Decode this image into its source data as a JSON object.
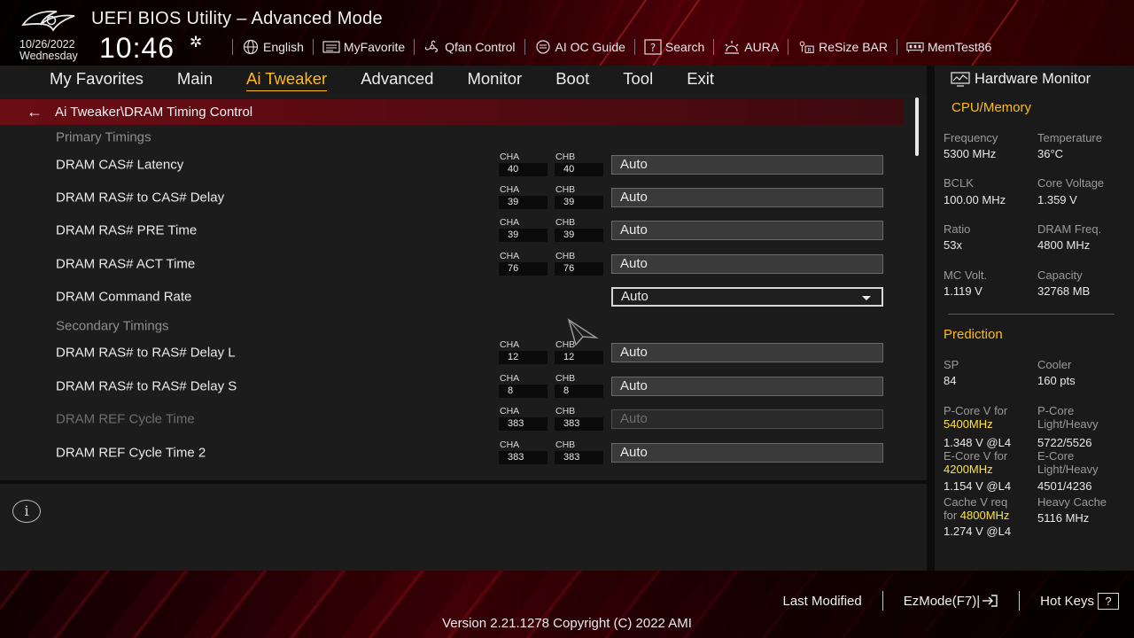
{
  "header": {
    "title": "UEFI BIOS Utility – Advanced Mode",
    "date": "10/26/2022",
    "weekday": "Wednesday",
    "time": "10:46"
  },
  "toolbar": {
    "items": [
      {
        "label": "English",
        "icon": "globe-icon"
      },
      {
        "label": "MyFavorite",
        "icon": "favorite-icon"
      },
      {
        "label": "Qfan Control",
        "icon": "fan-icon"
      },
      {
        "label": "AI OC Guide",
        "icon": "ai-chip-icon"
      },
      {
        "label": "Search",
        "icon": "search-icon"
      },
      {
        "label": "AURA",
        "icon": "aura-icon"
      },
      {
        "label": "ReSize BAR",
        "icon": "resize-bar-icon"
      },
      {
        "label": "MemTest86",
        "icon": "memtest-icon"
      }
    ]
  },
  "nav": {
    "tabs": [
      "My Favorites",
      "Main",
      "Ai Tweaker",
      "Advanced",
      "Monitor",
      "Boot",
      "Tool",
      "Exit"
    ],
    "active": "Ai Tweaker"
  },
  "breadcrumb": "Ai Tweaker\\DRAM Timing Control",
  "channel_labels": {
    "a": "CHA",
    "b": "CHB"
  },
  "settings": {
    "primary_header": "Primary Timings",
    "secondary_header": "Secondary Timings",
    "cas_latency": {
      "label": "DRAM CAS# Latency",
      "cha": "40",
      "chb": "40",
      "value": "Auto"
    },
    "ras_to_cas": {
      "label": "DRAM RAS# to CAS# Delay",
      "cha": "39",
      "chb": "39",
      "value": "Auto"
    },
    "ras_pre": {
      "label": "DRAM RAS# PRE Time",
      "cha": "39",
      "chb": "39",
      "value": "Auto"
    },
    "ras_act": {
      "label": "DRAM RAS# ACT Time",
      "cha": "76",
      "chb": "76",
      "value": "Auto"
    },
    "command_rate": {
      "label": "DRAM Command Rate",
      "value": "Auto"
    },
    "ras_to_ras_l": {
      "label": "DRAM RAS# to RAS# Delay L",
      "cha": "12",
      "chb": "12",
      "value": "Auto"
    },
    "ras_to_ras_s": {
      "label": "DRAM RAS# to RAS# Delay S",
      "cha": "8",
      "chb": "8",
      "value": "Auto"
    },
    "ref_cycle": {
      "label": "DRAM REF Cycle Time",
      "cha": "383",
      "chb": "383",
      "value": "Auto"
    },
    "ref_cycle_2": {
      "label": "DRAM REF Cycle Time 2",
      "cha": "383",
      "chb": "383",
      "value": "Auto"
    }
  },
  "hw_monitor": {
    "title": "Hardware Monitor",
    "cpu_memory_title": "CPU/Memory",
    "frequency_label": "Frequency",
    "frequency": "5300 MHz",
    "temperature_label": "Temperature",
    "temperature": "36°C",
    "bclk_label": "BCLK",
    "bclk": "100.00 MHz",
    "core_voltage_label": "Core Voltage",
    "core_voltage": "1.359 V",
    "ratio_label": "Ratio",
    "ratio": "53x",
    "dram_freq_label": "DRAM Freq.",
    "dram_freq": "4800 MHz",
    "mc_volt_label": "MC Volt.",
    "mc_volt": "1.119 V",
    "capacity_label": "Capacity",
    "capacity": "32768 MB",
    "prediction_title": "Prediction",
    "sp_label": "SP",
    "sp": "84",
    "cooler_label": "Cooler",
    "cooler": "160 pts",
    "pcore_v_label": "P-Core V for",
    "pcore_v_freq": "5400MHz",
    "pcore_v": "1.348 V @L4",
    "pcore_lh_label_1": "P-Core",
    "pcore_lh_label_2": "Light/Heavy",
    "pcore_lh": "5722/5526",
    "ecore_v_label": "E-Core V for",
    "ecore_v_freq": "4200MHz",
    "ecore_v": "1.154 V @L4",
    "ecore_lh_label_1": "E-Core",
    "ecore_lh_label_2": "Light/Heavy",
    "ecore_lh": "4501/4236",
    "cache_v_label_1": "Cache V req",
    "cache_v_label_2": "for",
    "cache_v_freq": "4800MHz",
    "cache_v": "1.274 V @L4",
    "heavy_cache_label": "Heavy Cache",
    "heavy_cache": "5116 MHz"
  },
  "footer": {
    "last_modified": "Last Modified",
    "ezmode": "EzMode(F7)|",
    "hot_keys": "Hot Keys",
    "hot_keys_key": "?",
    "version": "Version 2.21.1278 Copyright (C) 2022 AMI"
  },
  "colors": {
    "accent": "#ffbb1a",
    "highlight_freq": "#ffe23a",
    "brand_red": "#6b0d15"
  }
}
